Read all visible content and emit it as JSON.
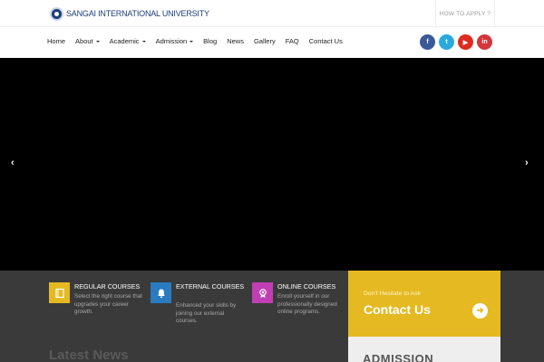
{
  "header": {
    "logo_text": "SANGAI INTERNATIONAL UNIVERSITY",
    "apply_label": "HOW TO APPLY ?"
  },
  "nav": {
    "items": [
      {
        "label": "Home"
      },
      {
        "label": "About",
        "dropdown": true
      },
      {
        "label": "Academic",
        "dropdown": true
      },
      {
        "label": "Admission",
        "dropdown": true
      },
      {
        "label": "Blog"
      },
      {
        "label": "News"
      },
      {
        "label": "Gallery"
      },
      {
        "label": "FAQ"
      },
      {
        "label": "Contact Us"
      }
    ]
  },
  "socials": {
    "facebook": "f",
    "twitter": "t",
    "youtube": "▶",
    "linkedin": "in"
  },
  "hero": {
    "prev_arrow": "‹",
    "next_arrow": "›"
  },
  "courses": [
    {
      "title": "REGULAR COURSES",
      "desc": "Select the right course that upgrades your career growth.",
      "color": "#e5b922",
      "icon": "book-icon"
    },
    {
      "title": "EXTERNAL COURSES",
      "desc": "Enhanced your skills by joining our external courses.",
      "color": "#2a7bbf",
      "icon": "bell-icon"
    },
    {
      "title": "ONLINE COURSES",
      "desc": "Enroll yourself in our professionally designed online programs.",
      "color": "#c03fb3",
      "icon": "badge-icon"
    }
  ],
  "contact": {
    "subtitle": "Don't Hesitate to Ask",
    "title": "Contact Us",
    "arrow": "➜"
  },
  "news": {
    "title": "Latest News"
  },
  "admission": {
    "title": "ADMISSION"
  },
  "colors": {
    "brand": "#1f3d7a",
    "accent": "#e5b922",
    "strip_bg": "#3a3a3a"
  }
}
